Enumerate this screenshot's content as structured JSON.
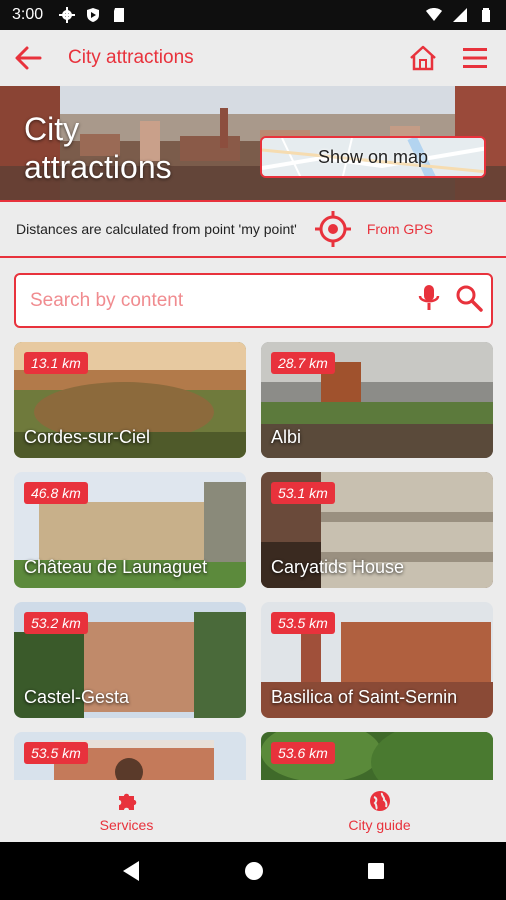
{
  "status_bar": {
    "time": "3:00",
    "left_icons": [
      "settings-icon",
      "shield-icon",
      "sd-card-icon"
    ],
    "right_icons": [
      "wifi-icon",
      "signal-icon",
      "battery-icon"
    ]
  },
  "app_bar": {
    "title": "City attractions",
    "icons": [
      "back-arrow-icon",
      "home-icon",
      "menu-icon"
    ]
  },
  "hero": {
    "title_line1": "City",
    "title_line2": "attractions",
    "map_button_label": "Show on map"
  },
  "distance": {
    "text": "Distances are calculated from point 'my point'",
    "gps_label": "From GPS"
  },
  "search": {
    "placeholder": "Search by content",
    "value": ""
  },
  "attractions": [
    {
      "distance": "13.1 km",
      "name": "Cordes-sur-Ciel"
    },
    {
      "distance": "28.7 km",
      "name": "Albi"
    },
    {
      "distance": "46.8 km",
      "name": "Château de Launaguet"
    },
    {
      "distance": "53.1 km",
      "name": "Caryatids House"
    },
    {
      "distance": "53.2 km",
      "name": "Castel-Gesta"
    },
    {
      "distance": "53.5 km",
      "name": "Basilica of Saint-Sernin"
    },
    {
      "distance": "53.5 km",
      "name": ""
    },
    {
      "distance": "53.6 km",
      "name": ""
    }
  ],
  "bottom_nav": {
    "services_label": "Services",
    "city_guide_label": "City guide"
  },
  "colors": {
    "accent": "#e8323c",
    "background": "#ececec"
  }
}
